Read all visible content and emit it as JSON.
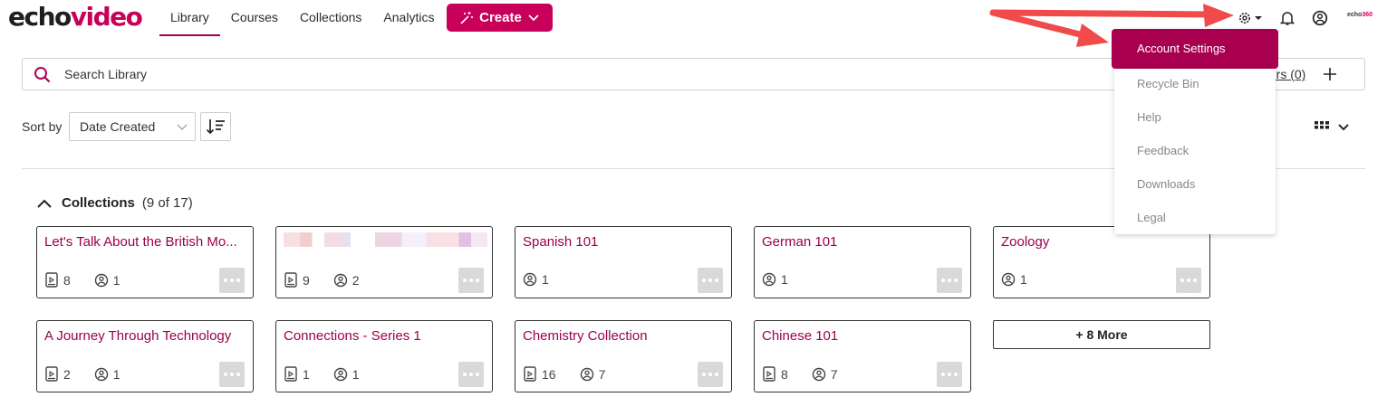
{
  "logo": {
    "part1": "echo",
    "part2": "video"
  },
  "nav": {
    "items": [
      {
        "label": "Library",
        "active": true
      },
      {
        "label": "Courses",
        "active": false
      },
      {
        "label": "Collections",
        "active": false
      },
      {
        "label": "Analytics",
        "active": false
      }
    ],
    "create_label": "Create"
  },
  "header_icons": [
    "gear-icon",
    "bell-icon",
    "user-icon"
  ],
  "brand_small": {
    "part1": "echo",
    "part2": "360"
  },
  "search": {
    "placeholder": "Search Library",
    "filters_label": "ters (0)"
  },
  "sort": {
    "label": "Sort by",
    "selected": "Date Created"
  },
  "collections": {
    "title": "Collections",
    "count": "(9 of 17)",
    "cards": [
      {
        "title": "Let's Talk About the British Mo...",
        "media": "8",
        "users": "1"
      },
      {
        "title": "",
        "media": "9",
        "users": "2",
        "blurred": true
      },
      {
        "title": "Spanish 101",
        "media": "",
        "users": "1"
      },
      {
        "title": "German 101",
        "media": "",
        "users": "1"
      },
      {
        "title": "Zoology",
        "media": "",
        "users": "1"
      },
      {
        "title": "A Journey Through Technology",
        "media": "2",
        "users": "1"
      },
      {
        "title": "Connections - Series 1",
        "media": "1",
        "users": "1"
      },
      {
        "title": "Chemistry Collection",
        "media": "16",
        "users": "7"
      },
      {
        "title": "Chinese 101",
        "media": "8",
        "users": "7"
      }
    ],
    "more_label": "+ 8 More"
  },
  "settings_menu": {
    "items": [
      "Account Settings",
      "Recycle Bin",
      "Help",
      "Feedback",
      "Downloads",
      "Legal"
    ],
    "active_index": 0
  },
  "colors": {
    "brand": "#c8005a",
    "active_menu": "#a8004f",
    "annotation_arrow": "#f04a4a"
  }
}
